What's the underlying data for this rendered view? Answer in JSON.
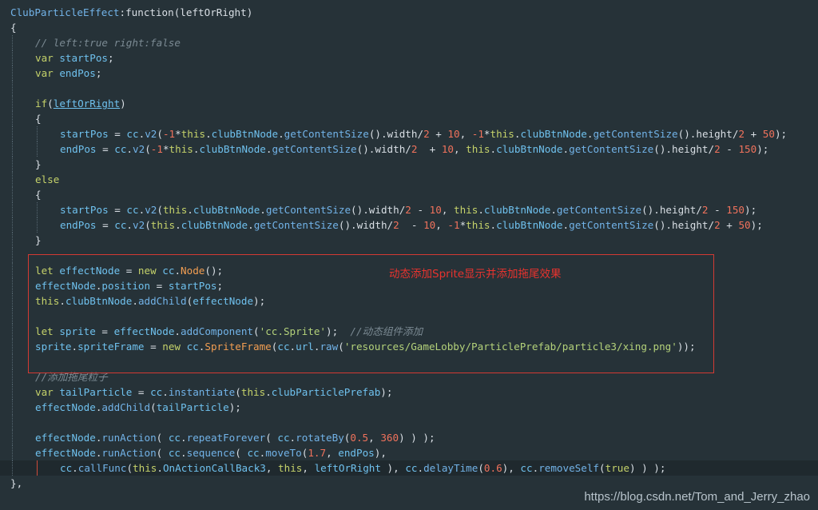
{
  "colors": {
    "background": "#263238",
    "plain": "#d9dfe5",
    "function": "#72b3e8",
    "keyword": "#c5d26a",
    "variable": "#6fc1ee",
    "string": "#b4d27a",
    "number": "#f0725c",
    "comment": "#7b8a93",
    "class": "#f29e52",
    "highlight_border": "#d33a33",
    "annotation": "#e8332e"
  },
  "annotation": "动态添加Sprite显示并添加拖尾效果",
  "watermark": "https://blog.csdn.net/Tom_and_Jerry_zhao",
  "cursor_line": 30,
  "code_lines": [
    {
      "guides": 0,
      "tokens": [
        [
          "fn",
          "ClubParticleEffect"
        ],
        [
          "plain",
          ":function(leftOrRight)"
        ]
      ]
    },
    {
      "guides": 0,
      "tokens": [
        [
          "plain",
          "{"
        ]
      ]
    },
    {
      "guides": 1,
      "tokens": [
        [
          "comment",
          "// left:true right:false"
        ]
      ]
    },
    {
      "guides": 1,
      "tokens": [
        [
          "kw",
          "var "
        ],
        [
          "var",
          "startPos"
        ],
        [
          "plain",
          ";"
        ]
      ]
    },
    {
      "guides": 1,
      "tokens": [
        [
          "kw",
          "var "
        ],
        [
          "var",
          "endPos"
        ],
        [
          "plain",
          ";"
        ]
      ]
    },
    {
      "guides": 1,
      "tokens": []
    },
    {
      "guides": 1,
      "tokens": [
        [
          "kw",
          "if"
        ],
        [
          "plain",
          "("
        ],
        [
          "varu",
          "leftOrRight"
        ],
        [
          "plain",
          ")"
        ]
      ]
    },
    {
      "guides": 1,
      "tokens": [
        [
          "plain",
          "{"
        ]
      ]
    },
    {
      "guides": 2,
      "tokens": [
        [
          "var",
          "startPos"
        ],
        [
          "plain",
          " = "
        ],
        [
          "var",
          "cc"
        ],
        [
          "plain",
          "."
        ],
        [
          "fn",
          "v2"
        ],
        [
          "plain",
          "("
        ],
        [
          "num",
          "-1"
        ],
        [
          "plain",
          "*"
        ],
        [
          "kw",
          "this"
        ],
        [
          "plain",
          "."
        ],
        [
          "var",
          "clubBtnNode"
        ],
        [
          "plain",
          "."
        ],
        [
          "fn",
          "getContentSize"
        ],
        [
          "plain",
          "().width/"
        ],
        [
          "num",
          "2"
        ],
        [
          "plain",
          " + "
        ],
        [
          "num",
          "10"
        ],
        [
          "plain",
          ", "
        ],
        [
          "num",
          "-1"
        ],
        [
          "plain",
          "*"
        ],
        [
          "kw",
          "this"
        ],
        [
          "plain",
          "."
        ],
        [
          "var",
          "clubBtnNode"
        ],
        [
          "plain",
          "."
        ],
        [
          "fn",
          "getContentSize"
        ],
        [
          "plain",
          "().height/"
        ],
        [
          "num",
          "2"
        ],
        [
          "plain",
          " + "
        ],
        [
          "num",
          "50"
        ],
        [
          "plain",
          ");"
        ]
      ]
    },
    {
      "guides": 2,
      "tokens": [
        [
          "var",
          "endPos"
        ],
        [
          "plain",
          " = "
        ],
        [
          "var",
          "cc"
        ],
        [
          "plain",
          "."
        ],
        [
          "fn",
          "v2"
        ],
        [
          "plain",
          "("
        ],
        [
          "num",
          "-1"
        ],
        [
          "plain",
          "*"
        ],
        [
          "kw",
          "this"
        ],
        [
          "plain",
          "."
        ],
        [
          "var",
          "clubBtnNode"
        ],
        [
          "plain",
          "."
        ],
        [
          "fn",
          "getContentSize"
        ],
        [
          "plain",
          "().width/"
        ],
        [
          "num",
          "2"
        ],
        [
          "plain",
          "  + "
        ],
        [
          "num",
          "10"
        ],
        [
          "plain",
          ", "
        ],
        [
          "kw",
          "this"
        ],
        [
          "plain",
          "."
        ],
        [
          "var",
          "clubBtnNode"
        ],
        [
          "plain",
          "."
        ],
        [
          "fn",
          "getContentSize"
        ],
        [
          "plain",
          "().height/"
        ],
        [
          "num",
          "2"
        ],
        [
          "plain",
          " - "
        ],
        [
          "num",
          "150"
        ],
        [
          "plain",
          ");"
        ]
      ]
    },
    {
      "guides": 1,
      "tokens": [
        [
          "plain",
          "}"
        ]
      ]
    },
    {
      "guides": 1,
      "tokens": [
        [
          "kw",
          "else"
        ]
      ]
    },
    {
      "guides": 1,
      "tokens": [
        [
          "plain",
          "{"
        ]
      ]
    },
    {
      "guides": 2,
      "tokens": [
        [
          "var",
          "startPos"
        ],
        [
          "plain",
          " = "
        ],
        [
          "var",
          "cc"
        ],
        [
          "plain",
          "."
        ],
        [
          "fn",
          "v2"
        ],
        [
          "plain",
          "("
        ],
        [
          "kw",
          "this"
        ],
        [
          "plain",
          "."
        ],
        [
          "var",
          "clubBtnNode"
        ],
        [
          "plain",
          "."
        ],
        [
          "fn",
          "getContentSize"
        ],
        [
          "plain",
          "().width/"
        ],
        [
          "num",
          "2"
        ],
        [
          "plain",
          " - "
        ],
        [
          "num",
          "10"
        ],
        [
          "plain",
          ", "
        ],
        [
          "kw",
          "this"
        ],
        [
          "plain",
          "."
        ],
        [
          "var",
          "clubBtnNode"
        ],
        [
          "plain",
          "."
        ],
        [
          "fn",
          "getContentSize"
        ],
        [
          "plain",
          "().height/"
        ],
        [
          "num",
          "2"
        ],
        [
          "plain",
          " - "
        ],
        [
          "num",
          "150"
        ],
        [
          "plain",
          ");"
        ]
      ]
    },
    {
      "guides": 2,
      "tokens": [
        [
          "var",
          "endPos"
        ],
        [
          "plain",
          " = "
        ],
        [
          "var",
          "cc"
        ],
        [
          "plain",
          "."
        ],
        [
          "fn",
          "v2"
        ],
        [
          "plain",
          "("
        ],
        [
          "kw",
          "this"
        ],
        [
          "plain",
          "."
        ],
        [
          "var",
          "clubBtnNode"
        ],
        [
          "plain",
          "."
        ],
        [
          "fn",
          "getContentSize"
        ],
        [
          "plain",
          "().width/"
        ],
        [
          "num",
          "2"
        ],
        [
          "plain",
          "  - "
        ],
        [
          "num",
          "10"
        ],
        [
          "plain",
          ", "
        ],
        [
          "num",
          "-1"
        ],
        [
          "plain",
          "*"
        ],
        [
          "kw",
          "this"
        ],
        [
          "plain",
          "."
        ],
        [
          "var",
          "clubBtnNode"
        ],
        [
          "plain",
          "."
        ],
        [
          "fn",
          "getContentSize"
        ],
        [
          "plain",
          "().height/"
        ],
        [
          "num",
          "2"
        ],
        [
          "plain",
          " + "
        ],
        [
          "num",
          "50"
        ],
        [
          "plain",
          ");"
        ]
      ]
    },
    {
      "guides": 1,
      "tokens": [
        [
          "plain",
          "}"
        ]
      ]
    },
    {
      "guides": 1,
      "tokens": []
    },
    {
      "guides": 1,
      "tokens": [
        [
          "kw",
          "let "
        ],
        [
          "var",
          "effectNode"
        ],
        [
          "plain",
          " = "
        ],
        [
          "kw",
          "new "
        ],
        [
          "var",
          "cc"
        ],
        [
          "plain",
          "."
        ],
        [
          "cls",
          "Node"
        ],
        [
          "plain",
          "();"
        ]
      ]
    },
    {
      "guides": 1,
      "tokens": [
        [
          "var",
          "effectNode"
        ],
        [
          "plain",
          "."
        ],
        [
          "var",
          "position"
        ],
        [
          "plain",
          " = "
        ],
        [
          "var",
          "startPos"
        ],
        [
          "plain",
          ";"
        ]
      ]
    },
    {
      "guides": 1,
      "tokens": [
        [
          "kw",
          "this"
        ],
        [
          "plain",
          "."
        ],
        [
          "var",
          "clubBtnNode"
        ],
        [
          "plain",
          "."
        ],
        [
          "fn",
          "addChild"
        ],
        [
          "plain",
          "("
        ],
        [
          "var",
          "effectNode"
        ],
        [
          "plain",
          ");"
        ]
      ]
    },
    {
      "guides": 1,
      "tokens": []
    },
    {
      "guides": 1,
      "tokens": [
        [
          "kw",
          "let "
        ],
        [
          "var",
          "sprite"
        ],
        [
          "plain",
          " = "
        ],
        [
          "var",
          "effectNode"
        ],
        [
          "plain",
          "."
        ],
        [
          "fn",
          "addComponent"
        ],
        [
          "plain",
          "("
        ],
        [
          "str",
          "'cc.Sprite'"
        ],
        [
          "plain",
          ");  "
        ],
        [
          "comment",
          "//动态组件添加"
        ]
      ]
    },
    {
      "guides": 1,
      "tokens": [
        [
          "var",
          "sprite"
        ],
        [
          "plain",
          "."
        ],
        [
          "var",
          "spriteFrame"
        ],
        [
          "plain",
          " = "
        ],
        [
          "kw",
          "new "
        ],
        [
          "var",
          "cc"
        ],
        [
          "plain",
          "."
        ],
        [
          "cls",
          "SpriteFrame"
        ],
        [
          "plain",
          "("
        ],
        [
          "var",
          "cc"
        ],
        [
          "plain",
          "."
        ],
        [
          "var",
          "url"
        ],
        [
          "plain",
          "."
        ],
        [
          "fn",
          "raw"
        ],
        [
          "plain",
          "("
        ],
        [
          "str",
          "'resources/GameLobby/ParticlePrefab/particle3/xing.png'"
        ],
        [
          "plain",
          "));"
        ]
      ]
    },
    {
      "guides": 1,
      "tokens": []
    },
    {
      "guides": 1,
      "tokens": [
        [
          "comment",
          "//添加拖尾粒子"
        ]
      ]
    },
    {
      "guides": 1,
      "tokens": [
        [
          "kw",
          "var "
        ],
        [
          "var",
          "tailParticle"
        ],
        [
          "plain",
          " = "
        ],
        [
          "var",
          "cc"
        ],
        [
          "plain",
          "."
        ],
        [
          "fn",
          "instantiate"
        ],
        [
          "plain",
          "("
        ],
        [
          "kw",
          "this"
        ],
        [
          "plain",
          "."
        ],
        [
          "var",
          "clubParticlePrefab"
        ],
        [
          "plain",
          ");"
        ]
      ]
    },
    {
      "guides": 1,
      "tokens": [
        [
          "var",
          "effectNode"
        ],
        [
          "plain",
          "."
        ],
        [
          "fn",
          "addChild"
        ],
        [
          "plain",
          "("
        ],
        [
          "var",
          "tailParticle"
        ],
        [
          "plain",
          ");"
        ]
      ]
    },
    {
      "guides": 1,
      "tokens": []
    },
    {
      "guides": 1,
      "tokens": [
        [
          "var",
          "effectNode"
        ],
        [
          "plain",
          "."
        ],
        [
          "fn",
          "runAction"
        ],
        [
          "plain",
          "( "
        ],
        [
          "var",
          "cc"
        ],
        [
          "plain",
          "."
        ],
        [
          "fn",
          "repeatForever"
        ],
        [
          "plain",
          "( "
        ],
        [
          "var",
          "cc"
        ],
        [
          "plain",
          "."
        ],
        [
          "fn",
          "rotateBy"
        ],
        [
          "plain",
          "("
        ],
        [
          "num",
          "0.5"
        ],
        [
          "plain",
          ", "
        ],
        [
          "num",
          "360"
        ],
        [
          "plain",
          ") ) );"
        ]
      ]
    },
    {
      "guides": 1,
      "tokens": [
        [
          "var",
          "effectNode"
        ],
        [
          "plain",
          "."
        ],
        [
          "fn",
          "runAction"
        ],
        [
          "plain",
          "( "
        ],
        [
          "var",
          "cc"
        ],
        [
          "plain",
          "."
        ],
        [
          "fn",
          "sequence"
        ],
        [
          "plain",
          "( "
        ],
        [
          "var",
          "cc"
        ],
        [
          "plain",
          "."
        ],
        [
          "fn",
          "moveTo"
        ],
        [
          "plain",
          "("
        ],
        [
          "num",
          "1.7"
        ],
        [
          "plain",
          ", "
        ],
        [
          "var",
          "endPos"
        ],
        [
          "plain",
          "),"
        ]
      ]
    },
    {
      "guides": 2,
      "tokens": [
        [
          "var",
          "cc"
        ],
        [
          "plain",
          "."
        ],
        [
          "fn",
          "callFunc"
        ],
        [
          "plain",
          "("
        ],
        [
          "kw",
          "this"
        ],
        [
          "plain",
          "."
        ],
        [
          "var",
          "OnActionCallBack3"
        ],
        [
          "plain",
          ", "
        ],
        [
          "kw",
          "this"
        ],
        [
          "plain",
          ", "
        ],
        [
          "var",
          "leftOrRight"
        ],
        [
          "plain",
          " ), "
        ],
        [
          "var",
          "cc"
        ],
        [
          "plain",
          "."
        ],
        [
          "fn",
          "delayTime"
        ],
        [
          "plain",
          "("
        ],
        [
          "num",
          "0.6"
        ],
        [
          "plain",
          "), "
        ],
        [
          "var",
          "cc"
        ],
        [
          "plain",
          "."
        ],
        [
          "fn",
          "removeSelf"
        ],
        [
          "plain",
          "("
        ],
        [
          "kw",
          "true"
        ],
        [
          "plain",
          ") ) );"
        ]
      ]
    },
    {
      "guides": 0,
      "tokens": [
        [
          "plain",
          "},"
        ]
      ]
    }
  ]
}
